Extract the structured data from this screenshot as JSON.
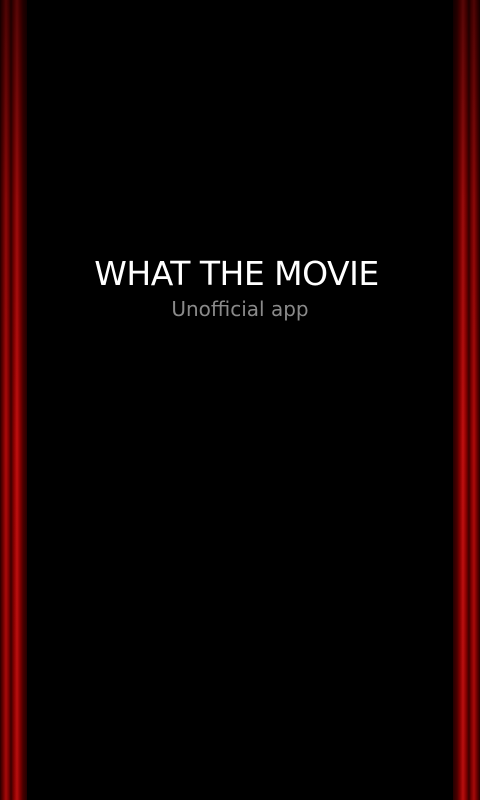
{
  "splash": {
    "title": "WHAT THE MOVIE",
    "subtitle": "Unofficial app"
  },
  "colors": {
    "background": "#000000",
    "curtain": "#b00a0a",
    "title": "#ffffff",
    "subtitle": "#8a8a8a"
  },
  "decor": {
    "left_curtain": "red-stage-curtain",
    "right_curtain": "red-stage-curtain"
  }
}
